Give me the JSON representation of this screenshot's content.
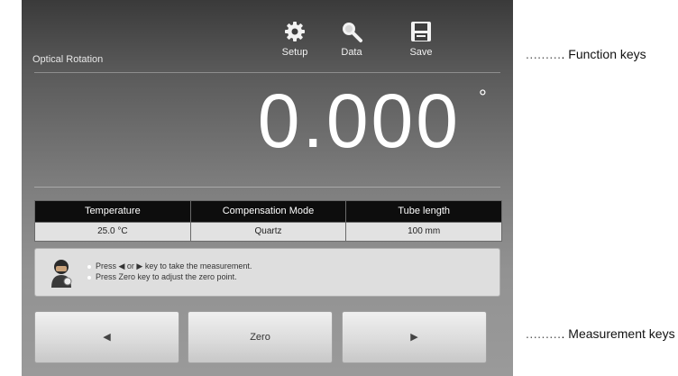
{
  "screen": {
    "title": "Optical Rotation",
    "function_keys": [
      {
        "label": "Setup",
        "icon": "gear-icon"
      },
      {
        "label": "Data",
        "icon": "magnifier-icon"
      },
      {
        "label": "Save",
        "icon": "floppy-disk-icon"
      }
    ],
    "reading": {
      "value": "0.000",
      "unit": "°"
    },
    "info_table": {
      "headers": [
        "Temperature",
        "Compensation Mode",
        "Tube length"
      ],
      "values": [
        "25.0 °C",
        "Quartz",
        "100 mm"
      ]
    },
    "guidance": {
      "icon": "operator-icon",
      "lines": [
        "Press ◀ or ▶ key to take the measurement.",
        "Press Zero key to adjust the zero point."
      ]
    },
    "measurement_keys": [
      {
        "label": "◀",
        "icon": "left-arrow-icon"
      },
      {
        "label": "Zero"
      },
      {
        "label": "▶",
        "icon": "right-arrow-icon"
      }
    ]
  },
  "annotations": {
    "dots": ".........",
    "function_keys_label": ". Function keys",
    "measurement_keys_label": ". Measurement keys"
  }
}
